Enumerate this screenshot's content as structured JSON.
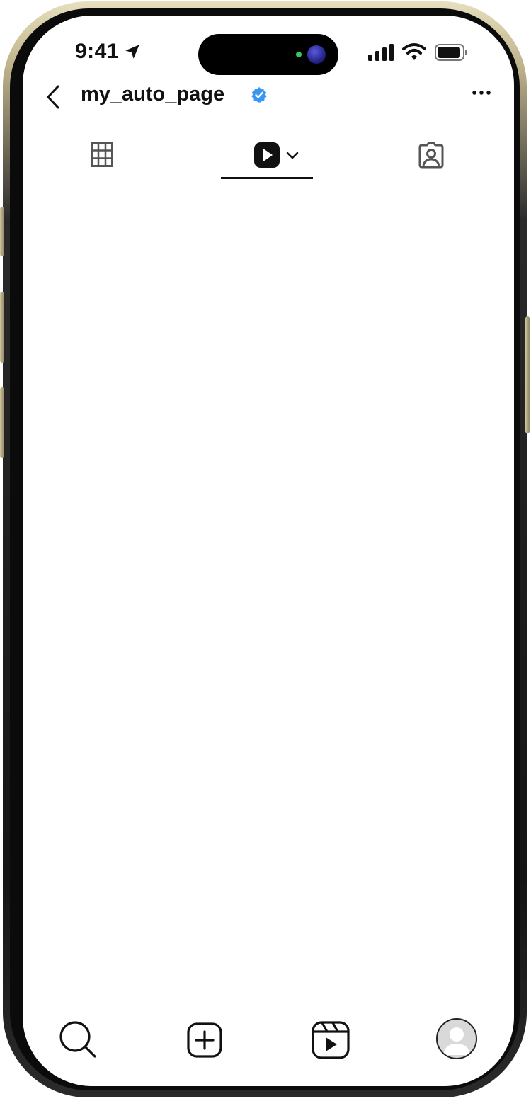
{
  "status_bar": {
    "time": "9:41",
    "icons": [
      "location-arrow-icon",
      "signal-bars-icon",
      "wifi-icon",
      "battery-icon"
    ]
  },
  "header": {
    "username": "my_auto_page",
    "verified": true,
    "icons": [
      "back-chevron-icon",
      "verified-badge-icon",
      "more-dots-icon"
    ]
  },
  "tabs": [
    {
      "id": "grid",
      "icon": "grid-icon",
      "active": false
    },
    {
      "id": "reels",
      "icon": "reels-play-icon",
      "active": true,
      "has_dropdown": true
    },
    {
      "id": "tagged",
      "icon": "tagged-person-icon",
      "active": false
    }
  ],
  "bottom_nav": [
    {
      "id": "search",
      "icon": "search-icon"
    },
    {
      "id": "create",
      "icon": "plus-square-icon"
    },
    {
      "id": "reels",
      "icon": "reels-icon"
    },
    {
      "id": "profile",
      "icon": "avatar-icon"
    }
  ],
  "colors": {
    "verified_blue": "#3897f0",
    "text": "#111111",
    "screen_bg": "#ffffff",
    "online_dot": "#35c75a"
  }
}
